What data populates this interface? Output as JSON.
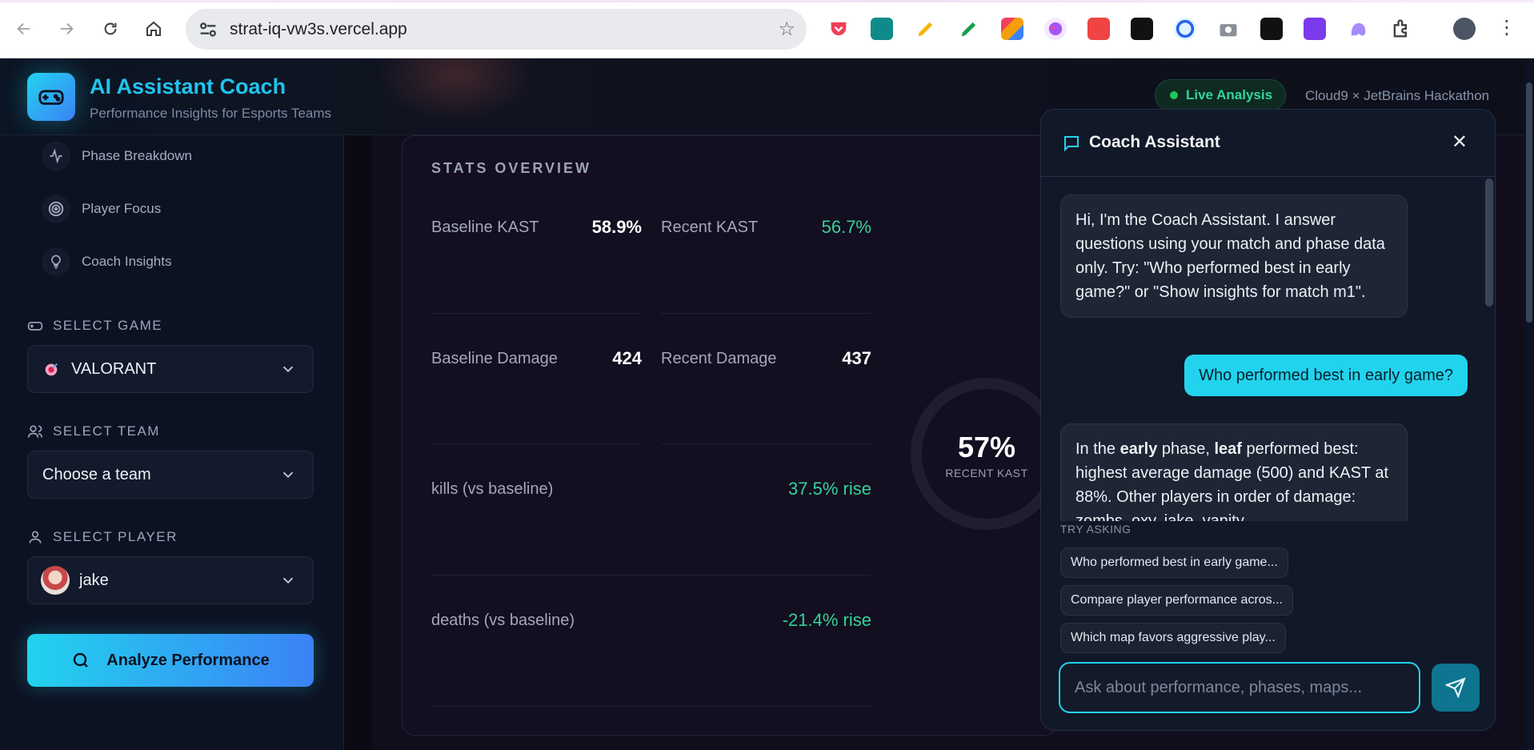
{
  "browser": {
    "url": "strat-iq-vw3s.vercel.app",
    "icons": [
      "back-icon",
      "forward-icon",
      "reload-icon",
      "home-icon",
      "site-settings-icon",
      "bookmark-star-icon",
      "menu-icon"
    ]
  },
  "header": {
    "title": "AI Assistant Coach",
    "subtitle": "Performance Insights for Esports Teams",
    "live_badge": "Live Analysis",
    "event": "Cloud9 × JetBrains Hackathon"
  },
  "sidebar": {
    "nav": [
      {
        "label": "Phase Breakdown",
        "icon": "activity-icon"
      },
      {
        "label": "Player Focus",
        "icon": "target-icon"
      },
      {
        "label": "Coach Insights",
        "icon": "lightbulb-icon"
      }
    ],
    "game": {
      "label": "SELECT GAME",
      "value": "VALORANT"
    },
    "team": {
      "label": "SELECT TEAM",
      "value": "Choose a team"
    },
    "player": {
      "label": "SELECT PLAYER",
      "value": "jake"
    },
    "analyze_label": "Analyze Performance"
  },
  "stats": {
    "title": "STATS OVERVIEW",
    "baseline_kast": {
      "label": "Baseline KAST",
      "value": "58.9%"
    },
    "recent_kast": {
      "label": "Recent KAST",
      "value": "56.7%"
    },
    "baseline_damage": {
      "label": "Baseline Damage",
      "value": "424"
    },
    "recent_damage": {
      "label": "Recent Damage",
      "value": "437"
    },
    "kills": {
      "label": "kills (vs baseline)",
      "value": "37.5% rise"
    },
    "deaths": {
      "label": "deaths (vs baseline)",
      "value": "-21.4% rise"
    },
    "ring": {
      "value": "57%",
      "label": "RECENT KAST",
      "fraction": 0.567
    }
  },
  "chat": {
    "title": "Coach Assistant",
    "messages": {
      "intro": "Hi, I'm the Coach Assistant. I answer questions using your match and phase data only. Try: \"Who performed best in early game?\" or \"Show insights for match m1\".",
      "user_q": "Who performed best in early game?",
      "reply_pre": "In the ",
      "reply_bold1": "early",
      "reply_mid": " phase, ",
      "reply_bold2": "leaf",
      "reply_post": " performed best: highest average damage (500) and KAST at 88%. Other players in order of damage: zombs, oxy, jake, vanity."
    },
    "try_label": "TRY ASKING",
    "suggestions": [
      "Who performed best in early game...",
      "Compare player performance acros...",
      "Which map favors aggressive play..."
    ],
    "input_placeholder": "Ask about performance, phases, maps..."
  },
  "colors": {
    "accent": "#22d3ee",
    "positive": "#34d399",
    "brand_gradient_end": "#3b82f6"
  }
}
